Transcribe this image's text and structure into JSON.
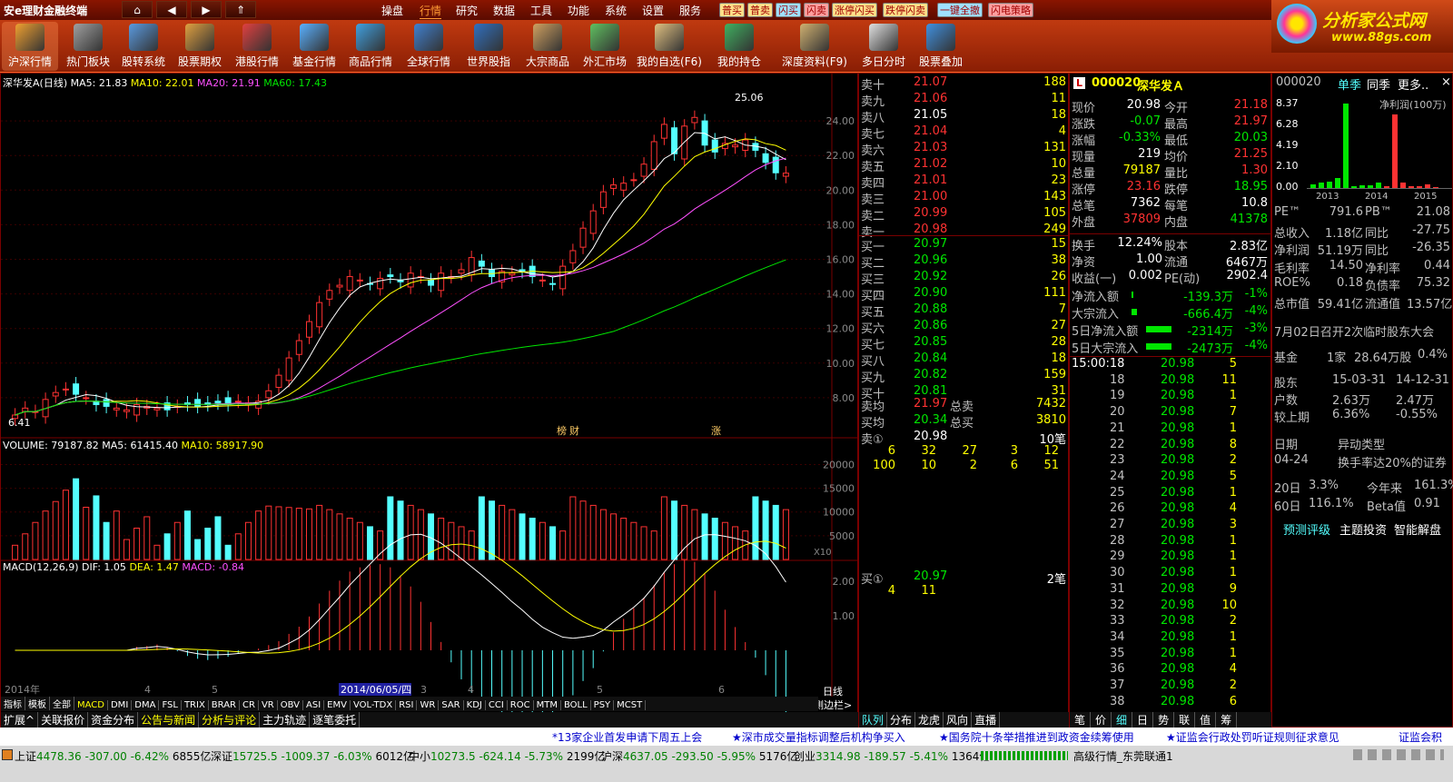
{
  "app": {
    "title": "安e理财金融终端",
    "menus": [
      "操盘",
      "行情",
      "研究",
      "数据",
      "工具",
      "功能",
      "系统",
      "设置",
      "服务"
    ],
    "tags": [
      {
        "t": "普买",
        "c": "#ffe08a"
      },
      {
        "t": "普卖",
        "c": "#ffe08a"
      },
      {
        "t": "闪买",
        "c": "#9fe0ff"
      },
      {
        "t": "闪卖",
        "c": "#ff9f9f"
      },
      {
        "t": "涨停闪买",
        "c": "#ffe08a"
      },
      {
        "t": "跌停闪卖",
        "c": "#ffe08a"
      },
      {
        "t": "一键全撤",
        "c": "#9fe0ff"
      },
      {
        "t": "闪电策略",
        "c": "#ff9f9f"
      }
    ]
  },
  "toolbar": [
    "沪深行情",
    "热门板块",
    "股转系统",
    "股票期权",
    "港股行情",
    "基金行情",
    "商品行情",
    "全球行情",
    "世界股指",
    "大宗商品",
    "外汇市场",
    "我的自选(F6)",
    "我的持仓",
    "深度资料(F9)",
    "多日分时",
    "股票叠加"
  ],
  "logo": {
    "name": "分析家公式网",
    "url": "www.88gs.com"
  },
  "chart": {
    "header": {
      "title": "深华发A(日线)",
      "ma5": "MA5: 21.83",
      "ma10": "MA10: 22.01",
      "ma20": "MA20: 21.91",
      "ma60": "MA60: 17.43"
    },
    "max_label": "25.06",
    "min_label": "6.41",
    "marker_a": "榜",
    "marker_b": "财",
    "marker_c": "涨",
    "yticks": [
      "24.00",
      "22.00",
      "20.00",
      "18.00",
      "16.00",
      "14.00",
      "12.00",
      "10.00",
      "8.00"
    ],
    "vol_header": {
      "title": "VOLUME: 79187.82",
      "ma5": "MA5: 61415.40",
      "ma10": "MA10: 58917.90"
    },
    "vol_ticks": [
      "20000",
      "15000",
      "10000",
      "5000"
    ],
    "vol_unit": "X10",
    "macd_header": {
      "title": "MACD(12,26,9)",
      "dif": "DIF: 1.05",
      "dea": "DEA: 1.47",
      "macd": "MACD: -0.84"
    },
    "macd_ticks": [
      "2.00",
      "1.00"
    ],
    "time_axis": [
      "2014年",
      "4",
      "5",
      "2014/06/05/四",
      "3",
      "4",
      "5",
      "6"
    ],
    "period": "日线",
    "side": "侧边栏>"
  },
  "chart_data": {
    "type": "candlestick",
    "title": "深华发A(日线)",
    "ylim": [
      6,
      26
    ],
    "high": 25.06,
    "low": 6.41,
    "close": [
      7.0,
      7.4,
      7.2,
      7.9,
      8.3,
      8.5,
      8.2,
      8.0,
      7.6,
      7.5,
      7.4,
      7.3,
      7.6,
      7.5,
      7.4,
      7.3,
      7.5,
      7.6,
      7.5,
      7.6,
      7.7,
      7.6,
      7.8,
      7.7,
      7.8,
      8.4,
      9.3,
      10.3,
      11.3,
      12.4,
      13.5,
      14.2,
      14.5,
      15.0,
      14.8,
      14.6,
      14.9,
      15.0,
      14.7,
      15.2,
      15.0,
      14.5,
      15.2,
      15.0,
      15.4,
      16.1,
      15.6,
      15.0,
      15.3,
      15.2,
      15.3,
      15.0,
      14.8,
      14.6,
      15.6,
      16.5,
      17.8,
      18.8,
      19.9,
      20.3,
      20.4,
      20.6,
      21.5,
      22.8,
      23.8,
      22.1,
      23.7,
      24.2,
      22.6,
      22.2,
      22.7,
      22.6,
      22.9,
      22.3,
      21.6,
      21.0,
      20.98
    ]
  },
  "mini_tabs": [
    "指标",
    "模板",
    "全部",
    "MACD",
    "DMI",
    "DMA",
    "FSL",
    "TRIX",
    "BRAR",
    "CR",
    "VR",
    "OBV",
    "ASI",
    "EMV",
    "VOL-TDX",
    "RSI",
    "WR",
    "SAR",
    "KDJ",
    "CCI",
    "ROC",
    "MTM",
    "BOLL",
    "PSY",
    "MCST"
  ],
  "bottom_tabs": [
    "扩展^",
    "关联报价",
    "资金分布",
    "公告与新闻",
    "分析与评论",
    "主力轨迹",
    "逐笔委托"
  ],
  "orderbook": {
    "sell": [
      [
        "卖十",
        "21.07",
        "188"
      ],
      [
        "卖九",
        "21.06",
        "11"
      ],
      [
        "卖八",
        "21.05",
        "18"
      ],
      [
        "卖七",
        "21.04",
        "4"
      ],
      [
        "卖六",
        "21.03",
        "131"
      ],
      [
        "卖五",
        "21.02",
        "10"
      ],
      [
        "卖四",
        "21.01",
        "23"
      ],
      [
        "卖三",
        "21.00",
        "143"
      ],
      [
        "卖二",
        "20.99",
        "105"
      ],
      [
        "卖一",
        "20.98",
        "249"
      ]
    ],
    "buy": [
      [
        "买一",
        "20.97",
        "15"
      ],
      [
        "买二",
        "20.96",
        "38"
      ],
      [
        "买三",
        "20.92",
        "26"
      ],
      [
        "买四",
        "20.90",
        "111"
      ],
      [
        "买五",
        "20.88",
        "7"
      ],
      [
        "买六",
        "20.86",
        "27"
      ],
      [
        "买七",
        "20.85",
        "28"
      ],
      [
        "买八",
        "20.84",
        "18"
      ],
      [
        "买九",
        "20.82",
        "159"
      ],
      [
        "买十",
        "20.81",
        "31"
      ]
    ],
    "avg": [
      [
        "卖均",
        "21.97",
        "总卖",
        "7432"
      ],
      [
        "买均",
        "20.34",
        "总买",
        "3810"
      ]
    ],
    "sell1": {
      "label": "卖①",
      "price": "20.98",
      "count": "10笔",
      "rows": [
        [
          "6",
          "32",
          "27",
          "3",
          "12"
        ],
        [
          "100",
          "10",
          "2",
          "6",
          "51"
        ]
      ]
    },
    "buy1": {
      "label": "买①",
      "price": "20.97",
      "count": "2笔",
      "rows": [
        [
          "4",
          "11"
        ]
      ]
    },
    "tabs": [
      "队列",
      "分布",
      "龙虎",
      "风向",
      "直播"
    ]
  },
  "quote": {
    "code": "000020",
    "name": "深华发Ａ",
    "mark": "L",
    "rows": [
      [
        "现价",
        "20.98",
        "今开",
        "21.18"
      ],
      [
        "涨跌",
        "-0.07",
        "最高",
        "21.97"
      ],
      [
        "涨幅",
        "-0.33%",
        "最低",
        "20.03"
      ],
      [
        "现量",
        "219",
        "均价",
        "21.25"
      ],
      [
        "总量",
        "79187",
        "量比",
        "1.30"
      ],
      [
        "涨停",
        "23.16",
        "跌停",
        "18.95"
      ],
      [
        "总笔",
        "7362",
        "每笔",
        "10.8"
      ],
      [
        "外盘",
        "37809",
        "内盘",
        "41378"
      ]
    ],
    "rows2": [
      [
        "换手",
        "12.24%",
        "股本",
        "2.83亿"
      ],
      [
        "净资",
        "1.00",
        "流通",
        "6467万"
      ],
      [
        "收益(一)",
        "0.002",
        "PE(动)",
        "2902.4"
      ]
    ],
    "flow": [
      [
        "净流入额",
        "-139.3万",
        "-1%"
      ],
      [
        "大宗流入",
        "-666.4万",
        "-4%"
      ],
      [
        "5日净流入额",
        "-2314万",
        "-3%"
      ],
      [
        "5日大宗流入",
        "-2473万",
        "-4%"
      ]
    ],
    "ticks": [
      [
        "15:00:18",
        "20.98",
        "5"
      ],
      [
        "18",
        "20.98",
        "11"
      ],
      [
        "19",
        "20.98",
        "1"
      ],
      [
        "20",
        "20.98",
        "7"
      ],
      [
        "21",
        "20.98",
        "1"
      ],
      [
        "22",
        "20.98",
        "8"
      ],
      [
        "23",
        "20.98",
        "2"
      ],
      [
        "24",
        "20.98",
        "5"
      ],
      [
        "25",
        "20.98",
        "1"
      ],
      [
        "26",
        "20.98",
        "4"
      ],
      [
        "27",
        "20.98",
        "3"
      ],
      [
        "28",
        "20.98",
        "1"
      ],
      [
        "29",
        "20.98",
        "1"
      ],
      [
        "30",
        "20.98",
        "1"
      ],
      [
        "31",
        "20.98",
        "9"
      ],
      [
        "32",
        "20.98",
        "10"
      ],
      [
        "33",
        "20.98",
        "2"
      ],
      [
        "34",
        "20.98",
        "1"
      ],
      [
        "35",
        "20.98",
        "1"
      ],
      [
        "36",
        "20.98",
        "4"
      ],
      [
        "37",
        "20.98",
        "2"
      ],
      [
        "38",
        "20.98",
        "6"
      ]
    ],
    "tabs": [
      "笔",
      "价",
      "细",
      "日",
      "势",
      "联",
      "值",
      "筹"
    ]
  },
  "fin": {
    "code": "000020",
    "tabs": [
      "单季",
      "同季",
      "更多..",
      "×"
    ],
    "unit": "净利润(100万)",
    "yticks": [
      "8.37",
      "6.28",
      "4.19",
      "2.10",
      "0.00"
    ],
    "years": [
      "2013",
      "2014",
      "2015"
    ],
    "bars": [
      0.4,
      0.5,
      0.6,
      1.0,
      8.3,
      0.2,
      0.3,
      0.3,
      0.5,
      0.2,
      7.2,
      0.5,
      0.2,
      0.2,
      0.4,
      0.1
    ],
    "rows": [
      [
        "PE™",
        "791.6",
        "PB™",
        "21.08"
      ],
      [
        "总收入",
        "1.18亿",
        "同比",
        "-27.75"
      ],
      [
        "净利润",
        "51.19万",
        "同比",
        "-26.35"
      ],
      [
        "毛利率",
        "14.50",
        "净利率",
        "0.44"
      ],
      [
        "ROE%",
        "0.18",
        "负债率",
        "75.32"
      ],
      [
        "总市值",
        "59.41亿",
        "流通值",
        "13.57亿"
      ]
    ],
    "notice": "7月02日召开2次临时股东大会",
    "fund": [
      "基金",
      "1家",
      "28.64万股",
      "0.4%"
    ],
    "holders": [
      [
        "股东",
        "15-03-31",
        "14-12-31"
      ],
      [
        "户数",
        "2.63万",
        "2.47万"
      ],
      [
        "较上期",
        "6.36%",
        "-0.55%"
      ]
    ],
    "abn": [
      [
        "日期",
        "异动类型"
      ],
      [
        "04-24",
        "换手率达20%的证券"
      ]
    ],
    "perf": [
      [
        "20日",
        "3.3%",
        "今年来",
        "161.3%"
      ],
      [
        "60日",
        "116.1%",
        "Beta值",
        "0.91"
      ]
    ],
    "links": [
      "预测评级",
      "主题投资",
      "智能解盘"
    ]
  },
  "news": [
    "*13家企业首发申请下周五上会",
    "★深市成交量指标调整后机构争买入",
    "★国务院十条举措推进到政资金续筹使用",
    "★证监会行政处罚听证规则征求意见",
    "证监会积"
  ],
  "status": {
    "indices": [
      [
        "上证",
        "4478.36",
        "-307.00",
        "-6.42%",
        "6855亿"
      ],
      [
        "深证",
        "15725.5",
        "-1009.37",
        "-6.03%",
        "6012亿"
      ],
      [
        "中小",
        "10273.5",
        "-624.14",
        "-5.73%",
        "2199亿"
      ],
      [
        "沪深",
        "4637.05",
        "-293.50",
        "-5.95%",
        "5176亿"
      ],
      [
        "创业",
        "3314.98",
        "-189.57",
        "-5.41%",
        "1364亿"
      ]
    ],
    "feed": "高级行情_东莞联通1"
  }
}
